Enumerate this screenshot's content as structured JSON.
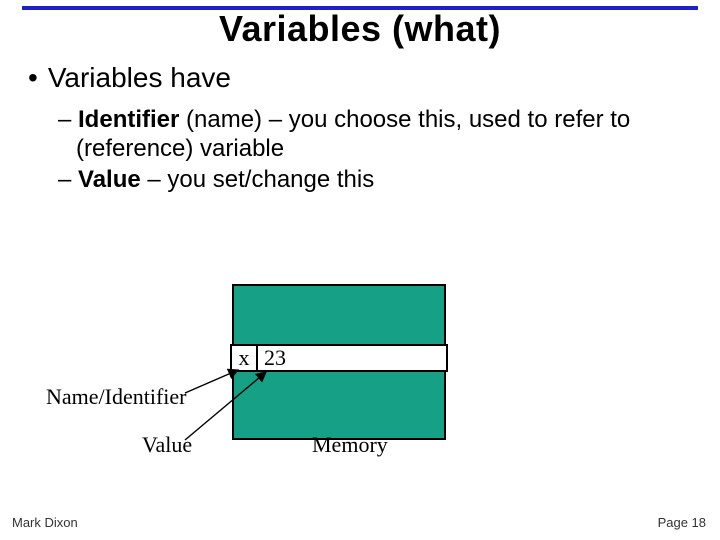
{
  "title": "Variables (what)",
  "bullet1": "Variables have",
  "sub1_bold": "Identifier",
  "sub1_after": " (name) – you choose this, used to refer to (reference) variable",
  "sub2_bold": "Value",
  "sub2_after": " – you set/change this",
  "diagram": {
    "var_name": "x",
    "var_value": "23",
    "label_name": "Name/Identifier",
    "label_value": "Value",
    "label_memory": "Memory"
  },
  "footer": {
    "author": "Mark Dixon",
    "page": "Page 18"
  }
}
